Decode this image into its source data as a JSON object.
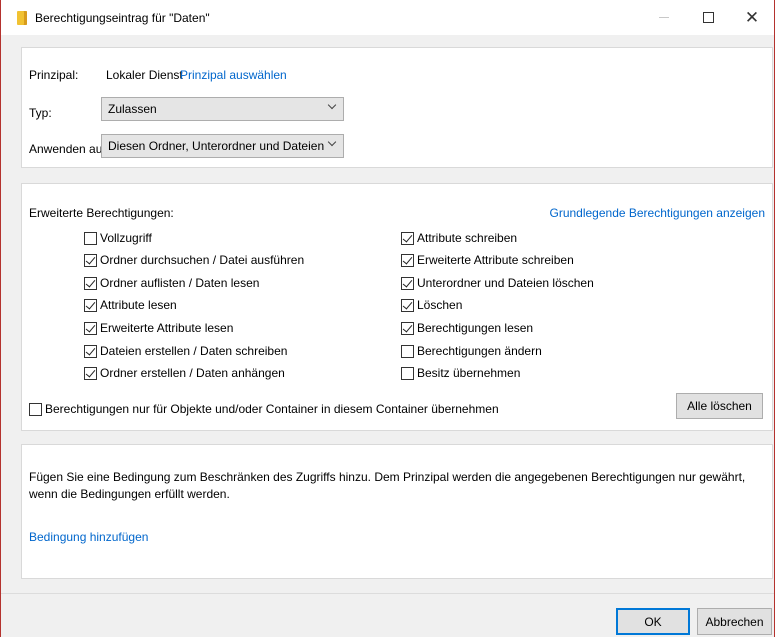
{
  "window": {
    "title": "Berechtigungseintrag für \"Daten\"",
    "controls": {
      "minimize_icon": "minimize-icon",
      "maximize_icon": "maximize-icon",
      "close_icon": "close-icon",
      "close_glyph": "✕"
    },
    "border_color": "#b4322e"
  },
  "principal": {
    "label": "Prinzipal:",
    "value": "Lokaler Dienst",
    "link": "Prinzipal auswählen"
  },
  "typ": {
    "label": "Typ:",
    "selected": "Zulassen"
  },
  "apply": {
    "label": "Anwenden auf:",
    "selected": "Diesen Ordner, Unterordner und Dateien"
  },
  "permissions": {
    "heading": "Erweiterte Berechtigungen:",
    "toggle_link": "Grundlegende Berechtigungen anzeigen",
    "left": [
      {
        "label": "Vollzugriff",
        "checked": false
      },
      {
        "label": "Ordner durchsuchen / Datei ausführen",
        "checked": true
      },
      {
        "label": "Ordner auflisten / Daten lesen",
        "checked": true
      },
      {
        "label": "Attribute lesen",
        "checked": true
      },
      {
        "label": "Erweiterte Attribute lesen",
        "checked": true
      },
      {
        "label": "Dateien erstellen / Daten schreiben",
        "checked": true
      },
      {
        "label": "Ordner erstellen / Daten anhängen",
        "checked": true
      }
    ],
    "right": [
      {
        "label": "Attribute schreiben",
        "checked": true
      },
      {
        "label": "Erweiterte Attribute schreiben",
        "checked": true
      },
      {
        "label": "Unterordner und Dateien löschen",
        "checked": true
      },
      {
        "label": "Löschen",
        "checked": true
      },
      {
        "label": "Berechtigungen lesen",
        "checked": true
      },
      {
        "label": "Berechtigungen ändern",
        "checked": false
      },
      {
        "label": "Besitz übernehmen",
        "checked": false
      }
    ],
    "inherit_only": {
      "label": "Berechtigungen nur für Objekte und/oder Container in diesem Container übernehmen",
      "checked": false
    },
    "clear_all_button": "Alle löschen"
  },
  "condition": {
    "text": "Fügen Sie eine Bedingung zum Beschränken des Zugriffs hinzu. Dem Prinzipal werden die angegebenen Berechtigungen nur gewährt, wenn die Bedingungen erfüllt werden.",
    "link": "Bedingung hinzufügen"
  },
  "footer": {
    "ok": "OK",
    "cancel": "Abbrechen"
  },
  "colors": {
    "link": "#0066cc",
    "default_button_border": "#0078d7"
  }
}
